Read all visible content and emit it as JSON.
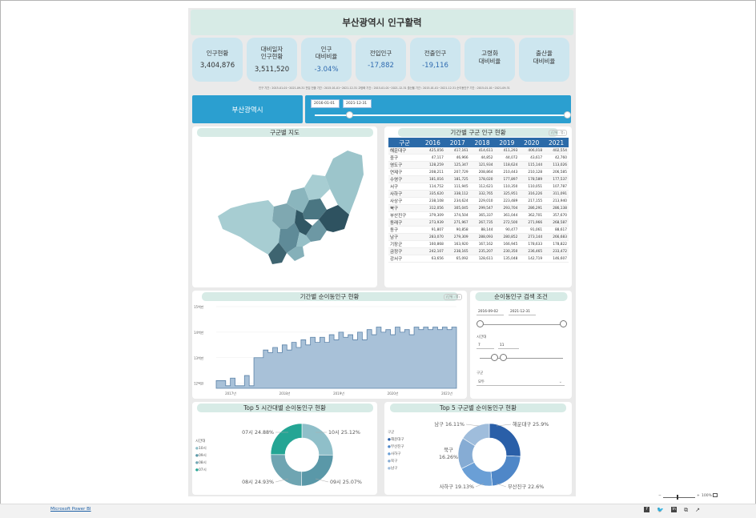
{
  "report": {
    "title": "부산광역시 인구활력"
  },
  "kpis": [
    {
      "label": "인구현황",
      "value": "3,404,876",
      "tone": ""
    },
    {
      "label": "대비일자\n인구현황",
      "value": "3,511,520",
      "tone": ""
    },
    {
      "label": "인구\n대비비율",
      "value": "-3.04%",
      "tone": "blue"
    },
    {
      "label": "전입인구",
      "value": "-17,882",
      "tone": "blue"
    },
    {
      "label": "전출인구",
      "value": "-19,116",
      "tone": "blue"
    },
    {
      "label": "고령화\n대비비율",
      "value": "",
      "tone": ""
    },
    {
      "label": "출산율\n대비비율",
      "value": "",
      "tone": ""
    }
  ],
  "periods_text": "인구 기간 : 2015-01-01~2021-09-31   전입 전출 기간 : 2015-01-01~2021-12-31   고령화 기간 : 2015-01-01~2021-12-31  출산율 기간 : 2015-01-01~2021-12-31   순이동인구 기간 : 2015-01-01~2021-09-31",
  "region_button": "부산광역시",
  "date_range": {
    "start": "2016-01-01",
    "end": "2021-12-31"
  },
  "map_panel": {
    "title": "구군별 지도"
  },
  "table_panel": {
    "title": "기간별 구군 인구 현황",
    "unit": "(단위 : 명)",
    "headers": [
      "구군",
      "2016",
      "2017",
      "2018",
      "2019",
      "2020",
      "2021"
    ],
    "rows": [
      [
        "해운대구",
        "425,056",
        "417,161",
        "414,611",
        "411,293",
        "406,018",
        "402,554"
      ],
      [
        "중구",
        "47,117",
        "46,966",
        "44,852",
        "44,072",
        "43,617",
        "42,760"
      ],
      [
        "영도구",
        "128,259",
        "125,347",
        "121,934",
        "118,624",
        "115,144",
        "113,026"
      ],
      [
        "연제구",
        "208,211",
        "207,729",
        "208,864",
        "210,443",
        "210,128",
        "206,585"
      ],
      [
        "수영구",
        "181,016",
        "181,725",
        "178,020",
        "177,897",
        "178,589",
        "177,537"
      ],
      [
        "서구",
        "114,752",
        "111,945",
        "112,621",
        "110,350",
        "110,051",
        "107,787"
      ],
      [
        "사하구",
        "335,620",
        "338,112",
        "332,765",
        "325,951",
        "316,226",
        "311,091"
      ],
      [
        "사상구",
        "238,108",
        "234,624",
        "229,010",
        "223,489",
        "217,155",
        "213,940"
      ],
      [
        "북구",
        "312,056",
        "305,045",
        "299,547",
        "293,704",
        "286,291",
        "286,138"
      ],
      [
        "부산진구",
        "379,309",
        "374,504",
        "365,337",
        "361,044",
        "362,701",
        "357,670"
      ],
      [
        "동래구",
        "273,939",
        "271,967",
        "267,735",
        "272,500",
        "271,966",
        "268,587"
      ],
      [
        "동구",
        "91,807",
        "90,858",
        "88,144",
        "90,477",
        "91,061",
        "88,617"
      ],
      [
        "남구",
        "283,070",
        "279,309",
        "288,093",
        "280,852",
        "273,144",
        "266,683"
      ],
      [
        "기장군",
        "160,868",
        "163,920",
        "167,162",
        "166,945",
        "178,633",
        "178,822"
      ],
      [
        "금정구",
        "242,107",
        "238,165",
        "235,207",
        "230,350",
        "236,465",
        "233,472"
      ],
      [
        "강서구",
        "63,656",
        "65,092",
        "128,611",
        "135,048",
        "142,719",
        "146,607"
      ]
    ]
  },
  "line_panel": {
    "title": "기간별 순이동인구 현황",
    "unit": "(단위 : 명)"
  },
  "filter_panel": {
    "title": "순이동인구 검색 조건",
    "date_start": "2016-09-02",
    "date_end": "2021-12-31",
    "hour_label": "시간대",
    "hour_start": "7",
    "hour_end": "11",
    "district_label": "구군",
    "district_value": "모두"
  },
  "donut1": {
    "title": "Top 5 시간대별 순이동인구 현황",
    "legend_title": "시간대",
    "legend": [
      "10시",
      "09시",
      "08시",
      "07시"
    ],
    "labels": [
      "07시 24.88%",
      "10시 25.12%",
      "08시 24.93%",
      "09시 25.07%"
    ]
  },
  "donut2": {
    "title": "Top 5 구군별 순이동인구 현황",
    "legend_title": "구군",
    "legend": [
      "해운대구",
      "부산진구",
      "사하구",
      "북구",
      "남구"
    ],
    "labels": [
      "남구 16.11%",
      "해운대구 25.9%",
      "북구\n16.26%",
      "사하구 19.13%",
      "부산진구 22.6%"
    ]
  },
  "chart_data": {
    "type": "area",
    "title": "기간별 순이동인구 현황",
    "ylabel": "",
    "y_ticks": [
      "12백만",
      "13백만",
      "14백만",
      "15백만"
    ],
    "x_ticks": [
      "2017년",
      "2018년",
      "2019년",
      "2020년",
      "2021년"
    ],
    "ylim": [
      11.8,
      15.0
    ],
    "values": [
      12.1,
      12.1,
      11.9,
      12.2,
      11.9,
      11.9,
      12.3,
      11.9,
      13.0,
      13.0,
      13.3,
      13.2,
      13.4,
      13.2,
      13.5,
      13.3,
      13.6,
      13.4,
      13.7,
      13.5,
      13.8,
      13.6,
      13.8,
      13.6,
      13.9,
      13.7,
      14.0,
      13.8,
      13.9,
      13.7,
      14.0,
      13.7,
      14.1,
      13.9,
      14.2,
      14.0,
      14.1,
      13.9,
      14.2,
      14.0,
      14.1,
      13.9,
      14.2,
      14.1,
      14.2,
      14.1,
      14.2,
      14.1,
      14.2,
      14.1,
      14.2,
      14.2
    ]
  },
  "footer": {
    "brand": "Microsoft Power BI",
    "zoom": "100%"
  }
}
